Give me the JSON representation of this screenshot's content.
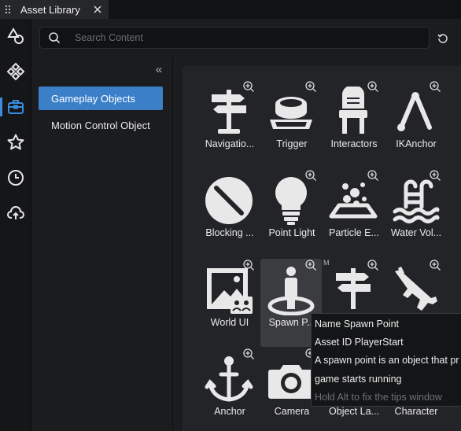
{
  "window": {
    "tab_title": "Asset Library"
  },
  "search": {
    "placeholder": "Search Content",
    "value": ""
  },
  "rail": {
    "items": [
      {
        "icon": "shapes-icon"
      },
      {
        "icon": "component-icon"
      },
      {
        "icon": "toolbox-icon",
        "active": true
      },
      {
        "icon": "star-icon"
      },
      {
        "icon": "clock-icon"
      },
      {
        "icon": "cloud-upload-icon"
      }
    ]
  },
  "categories": {
    "collapse_glyph": "«",
    "items": [
      {
        "label": "Gameplay Objects",
        "selected": true
      },
      {
        "label": "Motion Control Object",
        "selected": false
      }
    ]
  },
  "assets": [
    {
      "label": "Navigatio...",
      "icon": "signpost-icon"
    },
    {
      "label": "Trigger",
      "icon": "trigger-button-icon"
    },
    {
      "label": "Interactors",
      "icon": "interactor-icon"
    },
    {
      "label": "IKAnchor",
      "icon": "ik-anchor-icon"
    },
    {
      "label": "Blocking ...",
      "icon": "blocking-volume-icon"
    },
    {
      "label": "Point Light",
      "icon": "light-bulb-icon"
    },
    {
      "label": "Particle E...",
      "icon": "particle-emitter-icon"
    },
    {
      "label": "Water Vol...",
      "icon": "water-volume-icon"
    },
    {
      "label": "World UI",
      "icon": "world-ui-icon"
    },
    {
      "label": "Spawn P...",
      "icon": "spawn-point-icon",
      "hover": true
    },
    {
      "label": "",
      "icon": "signpost-icon",
      "badge": "M"
    },
    {
      "label": "",
      "icon": "rifle-icon"
    },
    {
      "label": "Anchor",
      "icon": "anchor-icon"
    },
    {
      "label": "Camera",
      "icon": "camera-icon"
    },
    {
      "label": "Object La...",
      "icon": "object-label-icon"
    },
    {
      "label": "Character",
      "icon": "character-icon"
    }
  ],
  "tooltip": {
    "name_line": "Name Spawn Point",
    "id_line": "Asset ID PlayerStart",
    "desc_line1": "A spawn point is an object that pr",
    "desc_line2": "game starts running",
    "hint": "Hold Alt to fix the tips window"
  },
  "colors": {
    "accent": "#3b7fc9",
    "rail_active": "#3b8be0",
    "icon": "#e8e8e8"
  }
}
